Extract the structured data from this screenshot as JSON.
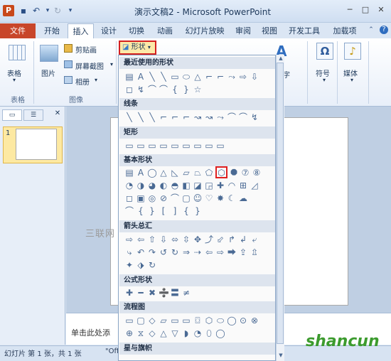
{
  "title": "演示文稿2 - Microsoft PowerPoint",
  "tabs": [
    "文件",
    "开始",
    "插入",
    "设计",
    "切换",
    "动画",
    "幻灯片放映",
    "审阅",
    "视图",
    "开发工具",
    "加载项"
  ],
  "ribbon": {
    "table": "表格",
    "picture": "图片",
    "clipart": "剪贴画",
    "screenshot": "屏幕截图",
    "album": "相册",
    "shapes": "形状",
    "symbol": "符号",
    "media": "媒体",
    "char_partial": "字",
    "group_table": "表格",
    "group_image": "图像"
  },
  "dropdown": {
    "recent": "最近使用的形状",
    "lines": "线条",
    "rect": "矩形",
    "basic": "基本形状",
    "arrows": "箭头总汇",
    "equation": "公式形状",
    "flow": "流程图",
    "stars": "星与旗帜",
    "rows": {
      "recent1": [
        "▤",
        "A",
        "╲",
        "╲",
        "▭",
        "⬭",
        "△",
        "⌐",
        "⌐",
        "⤳",
        "⇨",
        "⇩"
      ],
      "recent2": [
        "◻",
        "↯",
        "⌒",
        "⌒",
        "{",
        "}",
        "☆"
      ],
      "lines": [
        "╲",
        "╲",
        "╲",
        "⌐",
        "⌐",
        "⌐",
        "↝",
        "↝",
        "⤳",
        "⌒",
        "⌒",
        "↯"
      ],
      "rect": [
        "▭",
        "▭",
        "▭",
        "▭",
        "▭",
        "▭",
        "▭",
        "▭",
        "▭"
      ],
      "basic1": [
        "▤",
        "A",
        "◯",
        "△",
        "◺",
        "▱",
        "⏢",
        "⬠",
        "⬡",
        "⯃",
        "⑦",
        "⑧"
      ],
      "basic2": [
        "◔",
        "◑",
        "◕",
        "◐",
        "◓",
        "◧",
        "◪",
        "◲",
        "✚",
        "◠",
        "⊞",
        "◿"
      ],
      "basic3": [
        "◻",
        "▣",
        "◎",
        "⊘",
        "⌒",
        "▢",
        "☺",
        "♡",
        "✸",
        "☾",
        "☁"
      ],
      "basic4": [
        "⌒",
        "{",
        "}",
        "[",
        "]",
        "{",
        "}"
      ],
      "arrows1": [
        "⇨",
        "⇦",
        "⇧",
        "⇩",
        "⬄",
        "⇳",
        "✥",
        "⤴",
        "⬃",
        "↱",
        "↲",
        "⤶"
      ],
      "arrows2": [
        "⤷",
        "↶",
        "↷",
        "↺",
        "↻",
        "⇒",
        "⇢",
        "⇦",
        "⇨",
        "⮕",
        "⇪",
        "⇫"
      ],
      "arrows3": [
        "✦",
        "⬗",
        "↻"
      ],
      "equation": [
        "✚",
        "━",
        "✖",
        "➗",
        "〓",
        "≠"
      ],
      "flow1": [
        "▭",
        "▢",
        "◇",
        "▱",
        "▭",
        "▭",
        "⌼",
        "⬡",
        "⬭",
        "◯",
        "⊙",
        "⊗"
      ],
      "flow2": [
        "⊕",
        "⧖",
        "◇",
        "△",
        "▽",
        "◗",
        "◔",
        "⬯",
        "◯"
      ]
    }
  },
  "slides_tab": "1",
  "notes": "单击此处添",
  "status": "幻灯片 第 1 张，共 1 张",
  "status2": "\"Off",
  "watermark": "三联网 3LIAN.COM",
  "shancun": "shancun"
}
